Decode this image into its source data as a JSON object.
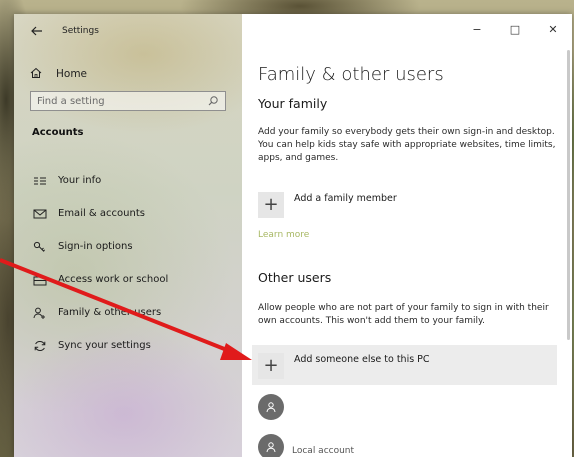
{
  "window": {
    "app_title": "Settings",
    "controls": {
      "minimize": "−",
      "maximize": "□",
      "close": "✕"
    }
  },
  "nav": {
    "home_label": "Home",
    "search_placeholder": "Find a setting",
    "section_label": "Accounts",
    "items": [
      {
        "label": "Your info",
        "icon": "person-list-icon"
      },
      {
        "label": "Email & accounts",
        "icon": "mail-icon"
      },
      {
        "label": "Sign-in options",
        "icon": "key-icon"
      },
      {
        "label": "Access work or school",
        "icon": "briefcase-icon"
      },
      {
        "label": "Family & other users",
        "icon": "person-add-icon"
      },
      {
        "label": "Sync your settings",
        "icon": "sync-icon"
      }
    ]
  },
  "content": {
    "page_title": "Family & other users",
    "your_family": {
      "heading": "Your family",
      "description": "Add your family so everybody gets their own sign-in and desktop. You can help kids stay safe with appropriate websites, time limits, apps, and games.",
      "add_label": "Add a family member",
      "learn_more": "Learn more"
    },
    "other_users": {
      "heading": "Other users",
      "description": "Allow people who are not part of your family to sign in with their own accounts. This won't add them to your family.",
      "add_label": "Add someone else to this PC",
      "users": [
        {
          "label": ""
        },
        {
          "label": "Local account"
        }
      ]
    }
  },
  "colors": {
    "annotation_arrow": "#e01b1b",
    "learn_more_link": "#a8b864",
    "highlight_row": "#ececec"
  }
}
